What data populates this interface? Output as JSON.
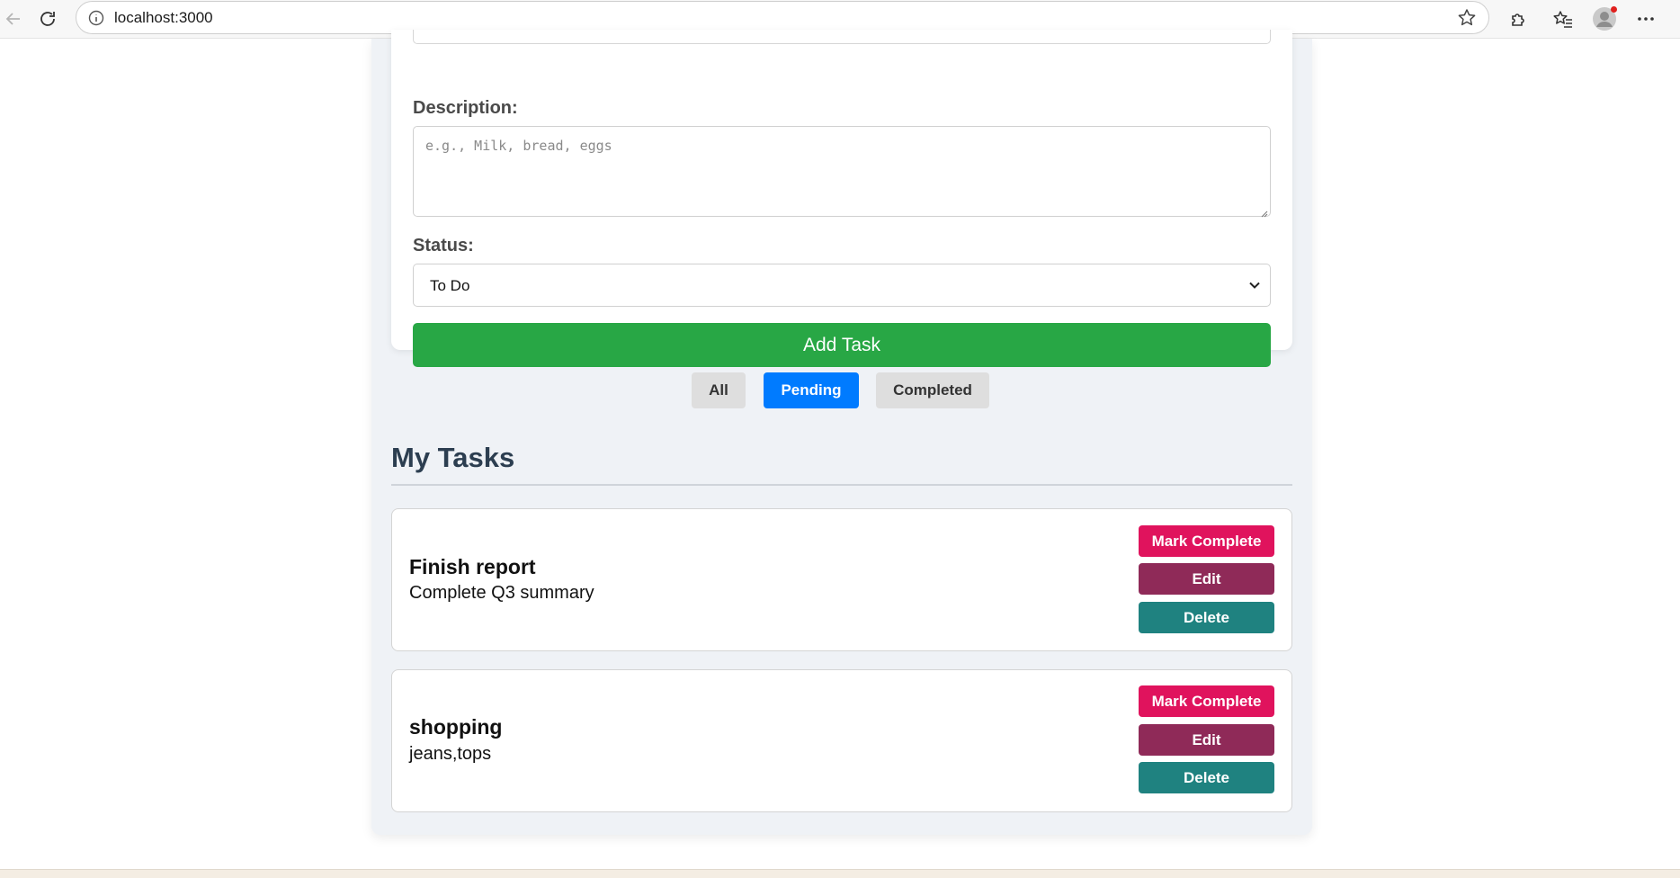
{
  "browser": {
    "url": "localhost:3000"
  },
  "form": {
    "description_label": "Description:",
    "description_placeholder": "e.g., Milk, bread, eggs",
    "status_label": "Status:",
    "status_value": "To Do",
    "add_button": "Add Task"
  },
  "filters": [
    {
      "label": "All",
      "active": false
    },
    {
      "label": "Pending",
      "active": true
    },
    {
      "label": "Completed",
      "active": false
    }
  ],
  "tasks_section": {
    "title": "My Tasks"
  },
  "tasks": [
    {
      "title": "Finish report",
      "description": "Complete Q3 summary",
      "complete_label": "Mark Complete",
      "edit_label": "Edit",
      "delete_label": "Delete"
    },
    {
      "title": "shopping",
      "description": "jeans,tops",
      "complete_label": "Mark Complete",
      "edit_label": "Edit",
      "delete_label": "Delete"
    }
  ],
  "colors": {
    "add_button": "#28a745",
    "filter_active": "#007bff",
    "mark_complete": "#e0135d",
    "edit": "#8f2a58",
    "delete": "#1f8280",
    "heading": "#2c3e50"
  },
  "icons": {
    "back": "back-arrow-icon",
    "reload": "reload-icon",
    "site_info": "info-icon",
    "favorite": "star-icon",
    "extensions": "puzzle-icon",
    "favorites_list": "favorites-icon",
    "profile": "avatar-icon",
    "menu": "more-icon"
  }
}
